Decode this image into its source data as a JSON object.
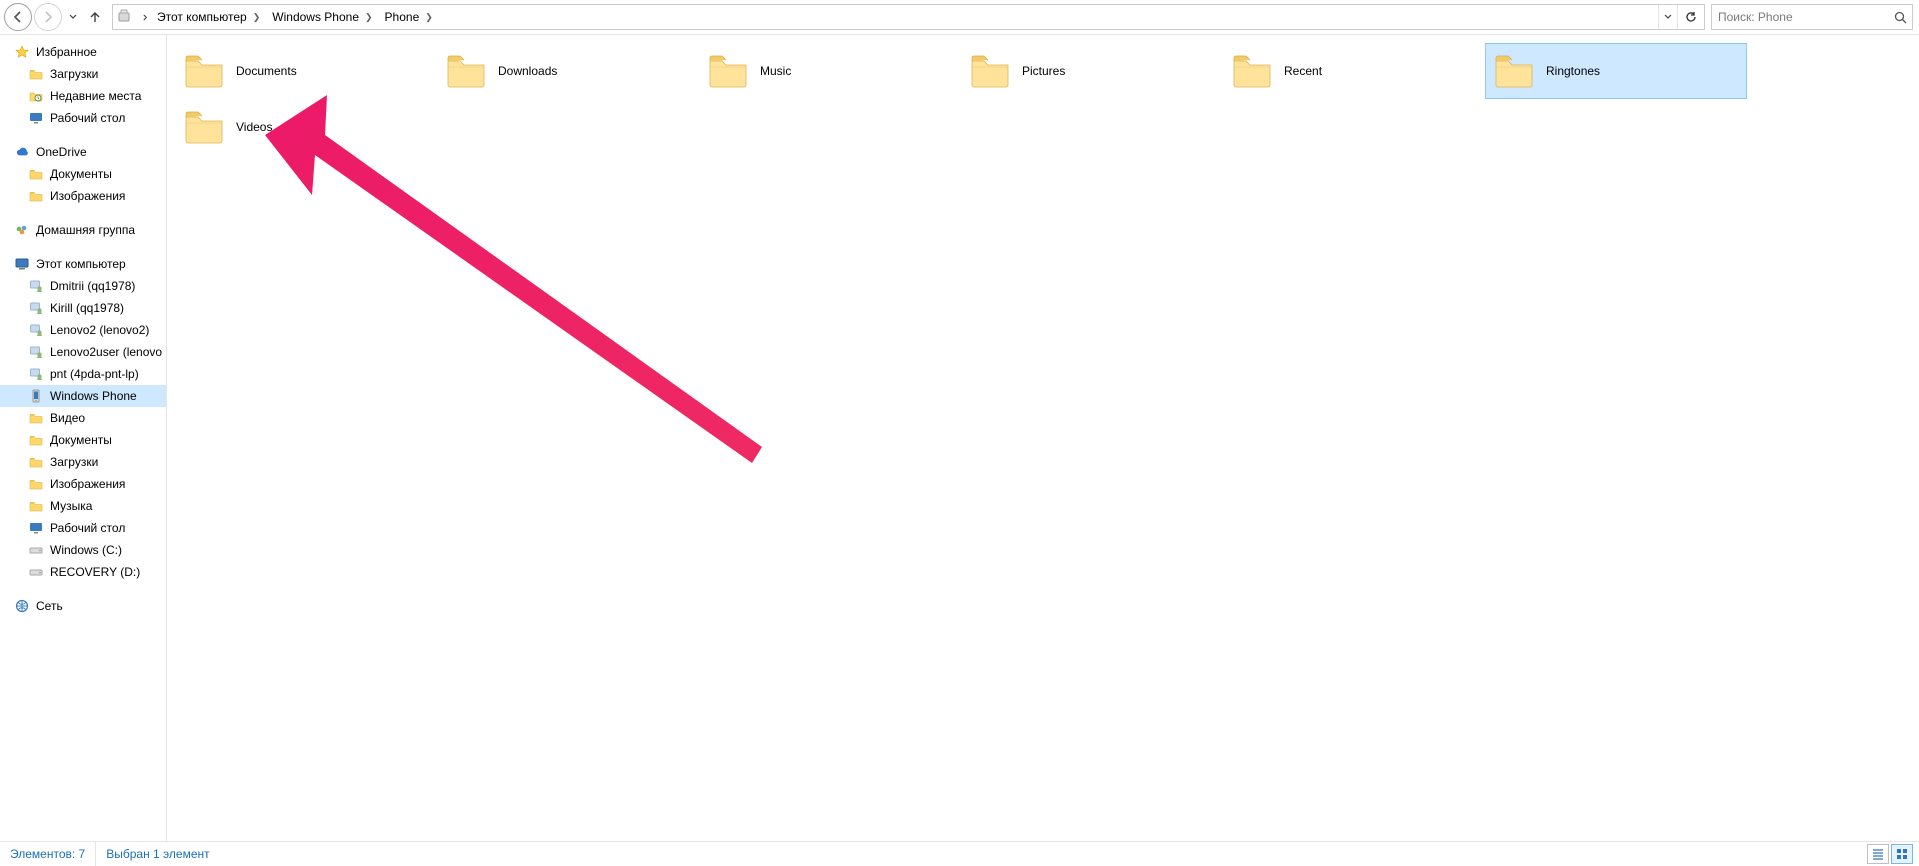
{
  "breadcrumb": {
    "segments": [
      "Этот компьютер",
      "Windows Phone",
      "Phone"
    ]
  },
  "search": {
    "placeholder": "Поиск: Phone"
  },
  "sidebar": {
    "favorites": {
      "label": "Избранное",
      "items": [
        {
          "label": "Загрузки",
          "icon": "folder"
        },
        {
          "label": "Недавние места",
          "icon": "recent"
        },
        {
          "label": "Рабочий стол",
          "icon": "desktop"
        }
      ]
    },
    "onedrive": {
      "label": "OneDrive",
      "items": [
        {
          "label": "Документы",
          "icon": "folder"
        },
        {
          "label": "Изображения",
          "icon": "folder"
        }
      ]
    },
    "homegroup": {
      "label": "Домашняя группа",
      "items": []
    },
    "thispc": {
      "label": "Этот компьютер",
      "items": [
        {
          "label": "Dmitrii (qq1978)",
          "icon": "user"
        },
        {
          "label": "Kirill (qq1978)",
          "icon": "user"
        },
        {
          "label": "Lenovo2 (lenovo2)",
          "icon": "user"
        },
        {
          "label": "Lenovo2user (lenovo",
          "icon": "user"
        },
        {
          "label": "pnt (4pda-pnt-lp)",
          "icon": "user"
        },
        {
          "label": "Windows Phone",
          "icon": "phone",
          "selected": true
        },
        {
          "label": "Видео",
          "icon": "folder"
        },
        {
          "label": "Документы",
          "icon": "folder"
        },
        {
          "label": "Загрузки",
          "icon": "folder"
        },
        {
          "label": "Изображения",
          "icon": "folder"
        },
        {
          "label": "Музыка",
          "icon": "folder"
        },
        {
          "label": "Рабочий стол",
          "icon": "desktop"
        },
        {
          "label": "Windows (C:)",
          "icon": "drive"
        },
        {
          "label": "RECOVERY (D:)",
          "icon": "drive"
        }
      ]
    },
    "network": {
      "label": "Сеть",
      "items": []
    }
  },
  "content": {
    "items": [
      {
        "label": "Documents"
      },
      {
        "label": "Downloads"
      },
      {
        "label": "Music"
      },
      {
        "label": "Pictures"
      },
      {
        "label": "Recent"
      },
      {
        "label": "Ringtones",
        "selected": true
      },
      {
        "label": "Videos"
      }
    ]
  },
  "status": {
    "count_label": "Элементов: 7",
    "sel_label": "Выбран 1 элемент"
  }
}
